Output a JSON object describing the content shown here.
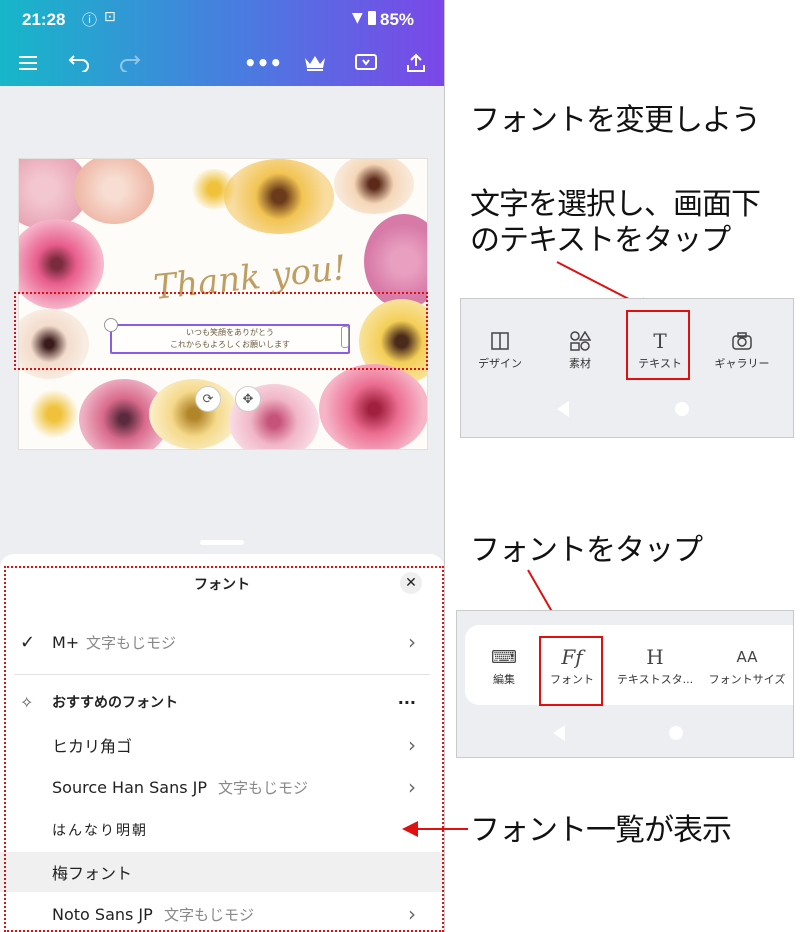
{
  "status_bar": {
    "time": "21:28",
    "battery": "85%"
  },
  "toolbar": {
    "icons": [
      "menu-icon",
      "undo-icon",
      "redo-icon",
      "more-icon",
      "crown-icon",
      "present-icon",
      "share-icon"
    ]
  },
  "design": {
    "script_text": "Thank you!",
    "message_line1": "いつも笑顔をありがとう",
    "message_line2": "これからもよろしくお願いします"
  },
  "font_sheet": {
    "title": "フォント",
    "current_font": {
      "name": "M+",
      "sample": "文字もじモジ"
    },
    "recommended_header": "おすすめのフォント",
    "more_label": "···",
    "fonts": [
      {
        "name": "ヒカリ角ゴ",
        "sample": ""
      },
      {
        "name": "Source Han Sans JP",
        "sample": "文字もじモジ"
      },
      {
        "name": "はんなり明朝",
        "sample": ""
      },
      {
        "name": "梅フォント",
        "sample": ""
      },
      {
        "name": "Noto Sans JP",
        "sample": "文字もじモジ"
      }
    ]
  },
  "captions": {
    "change_font": "フォントを変更しよう",
    "select_text_line1": "文字を選択し、画面下",
    "select_text_line2": "のテキストをタップ",
    "tap_font": "フォントをタップ",
    "font_list_shown": "フォント一覧が表示"
  },
  "panel_bottom_menu": {
    "items": [
      {
        "label": "デザイン",
        "icon": "layout-icon"
      },
      {
        "label": "素材",
        "icon": "shapes-icon"
      },
      {
        "label": "テキスト",
        "icon": "text-icon"
      },
      {
        "label": "ギャラリー",
        "icon": "camera-icon"
      }
    ]
  },
  "panel_text_menu": {
    "items": [
      {
        "label": "編集",
        "icon": "keyboard-icon",
        "glyph": "⌨"
      },
      {
        "label": "フォント",
        "icon": "font-icon",
        "glyph": "Ff"
      },
      {
        "label": "テキストスタ...",
        "icon": "heading-icon",
        "glyph": "H"
      },
      {
        "label": "フォントサイズ",
        "icon": "font-size-icon",
        "glyph": "AA"
      }
    ]
  },
  "colors": {
    "accent_red": "#e01010",
    "selection_purple": "#8b5ce6",
    "gradient_start": "#16b7c9",
    "gradient_end": "#7b47e8"
  }
}
